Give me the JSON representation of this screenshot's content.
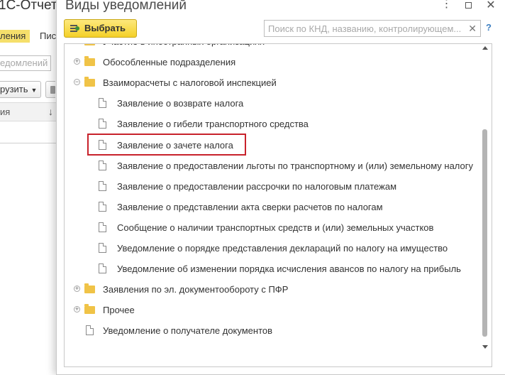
{
  "background_window": {
    "title": "1С-Отчет",
    "tab_active": "ления",
    "tab_other": "Пис",
    "search_placeholder": "едомлений",
    "load_button": "рузить",
    "column_header": "ия",
    "sort_icon": "↓"
  },
  "dialog": {
    "title": "Виды уведомлений",
    "select_button": "Выбрать",
    "search_placeholder": "Поиск по КНД, названию, контролирующем...",
    "help": "?",
    "more_icon": "⋮",
    "close_icon": "✕",
    "tree": [
      {
        "label": "Участие в иностранных организациях",
        "kind": "folder",
        "expander": "plus"
      },
      {
        "label": "Обособленные подразделения",
        "kind": "folder",
        "expander": "plus"
      },
      {
        "label": "Взаиморасчеты с налоговой инспекцией",
        "kind": "folder",
        "expander": "minus"
      },
      {
        "label": "Заявление о возврате налога",
        "kind": "doc"
      },
      {
        "label": "Заявление о гибели транспортного средства",
        "kind": "doc"
      },
      {
        "label": "Заявление о зачете налога",
        "kind": "doc",
        "highlighted": true
      },
      {
        "label": "Заявление о предоставлении льготы по транспортному и (или) земельному налогу",
        "kind": "doc"
      },
      {
        "label": "Заявление о предоставлении рассрочки по налоговым платежам",
        "kind": "doc"
      },
      {
        "label": "Заявление о представлении акта сверки расчетов по налогам",
        "kind": "doc"
      },
      {
        "label": "Сообщение о наличии транспортных средств и (или) земельных участков",
        "kind": "doc"
      },
      {
        "label": "Уведомление о порядке представления деклараций по налогу на имущество",
        "kind": "doc"
      },
      {
        "label": "Уведомление об изменении порядка исчисления авансов по налогу на прибыль",
        "kind": "doc"
      },
      {
        "label": "Заявления по эл. документообороту с ПФР",
        "kind": "folder",
        "expander": "plus"
      },
      {
        "label": "Прочее",
        "kind": "folder",
        "expander": "plus"
      },
      {
        "label": "Уведомление о получателе документов",
        "kind": "root-doc"
      }
    ],
    "highlight_color": "#c8222b",
    "button_color": "#f4d028"
  }
}
